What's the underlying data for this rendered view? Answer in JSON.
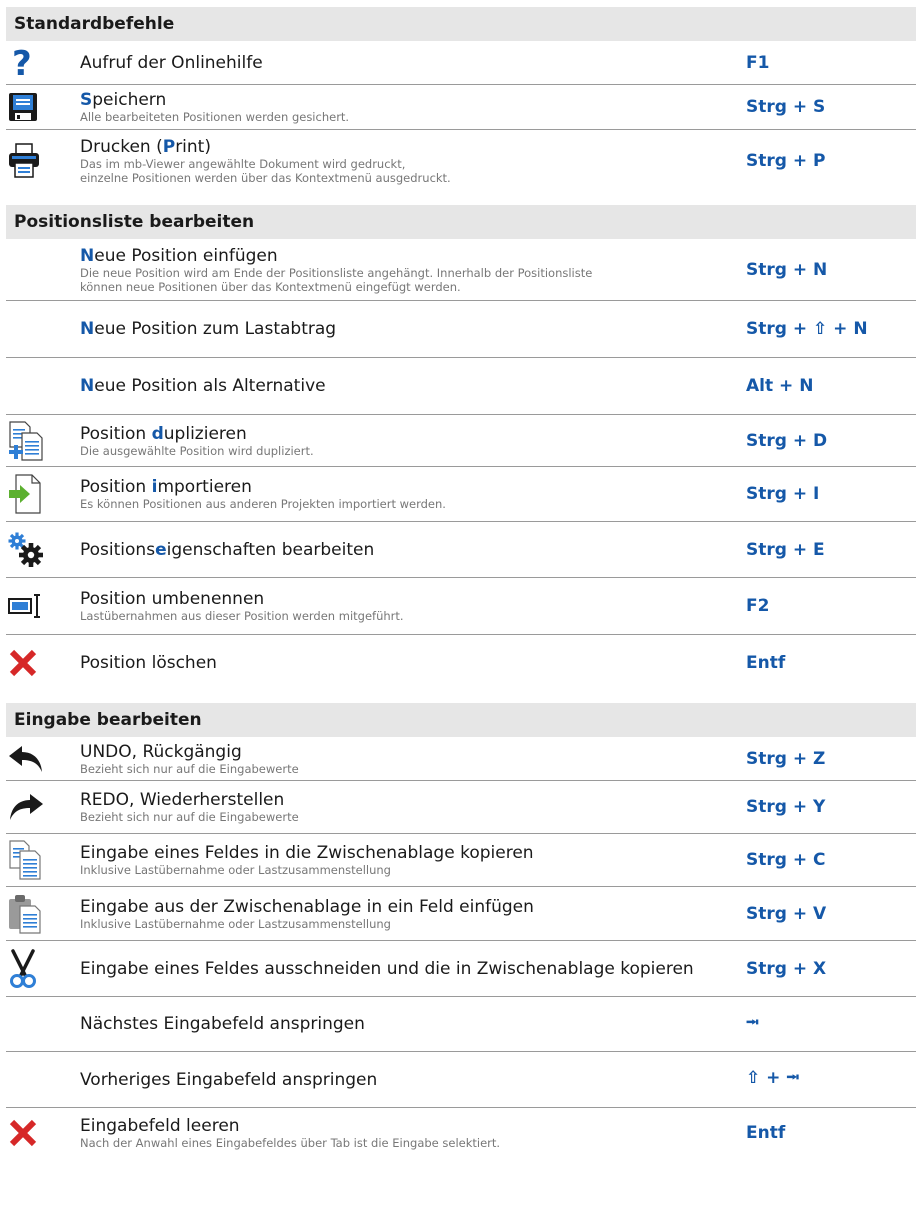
{
  "sections": {
    "standard": "Standardbefehle",
    "positions": "Positionsliste bearbeiten",
    "input": "Eingabe bearbeiten"
  },
  "rows": {
    "help": {
      "title": "Aufruf der Onlinehilfe",
      "key": "F1"
    },
    "save": {
      "hl": "S",
      "rest": "peichern",
      "sub": "Alle bearbeiteten Positionen werden gesichert.",
      "key": "Strg + S"
    },
    "print": {
      "pre": "Drucken (",
      "hl": "P",
      "post": "rint)",
      "sub1": "Das im mb-Viewer angewählte Dokument wird gedruckt,",
      "sub2": "einzelne Positionen werden über das Kontextmenü ausgedruckt.",
      "key": "Strg + P"
    },
    "newpos": {
      "hl": "N",
      "rest": "eue Position einfügen",
      "sub1": "Die neue Position wird am Ende der Positionsliste angehängt. Innerhalb der Positionsliste",
      "sub2": "können neue Positionen über das Kontextmenü eingefügt werden.",
      "key": "Strg + N"
    },
    "newload": {
      "hl": "N",
      "rest": "eue Position zum Lastabtrag",
      "key": "Strg + ⇧ + N"
    },
    "newalt": {
      "hl": "N",
      "rest": "eue Position als Alternative",
      "key": "Alt + N"
    },
    "dup": {
      "pre": "Position ",
      "hl": "d",
      "post": "uplizieren",
      "sub": "Die ausgewählte Position wird dupliziert.",
      "key": "Strg + D"
    },
    "import": {
      "pre": "Position ",
      "hl": "i",
      "post": "mportieren",
      "sub": "Es können Positionen aus anderen Projekten importiert werden.",
      "key": "Strg + I"
    },
    "props": {
      "pre": "Positions",
      "hl": "e",
      "post": "igenschaften bearbeiten",
      "key": "Strg + E"
    },
    "rename": {
      "title": "Position umbenennen",
      "sub": "Lastübernahmen aus dieser Position werden mitgeführt.",
      "key": "F2"
    },
    "delete": {
      "title": "Position löschen",
      "key": "Entf"
    },
    "undo": {
      "title": "UNDO, Rückgängig",
      "sub": "Bezieht sich nur auf die Eingabewerte",
      "key": "Strg + Z"
    },
    "redo": {
      "title": "REDO, Wiederherstellen",
      "sub": "Bezieht sich nur auf die Eingabewerte",
      "key": "Strg + Y"
    },
    "copy": {
      "title": "Eingabe eines Feldes in die Zwischenablage kopieren",
      "sub": "Inklusive Lastübernahme oder Lastzusammenstellung",
      "key": "Strg + C"
    },
    "paste": {
      "title": "Eingabe aus der Zwischenablage in ein Feld einfügen",
      "sub": "Inklusive Lastübernahme oder Lastzusammenstellung",
      "key": "Strg + V"
    },
    "cut": {
      "title": "Eingabe eines Feldes ausschneiden und die in Zwischenablage kopieren",
      "key": "Strg + X"
    },
    "next": {
      "title": "Nächstes Eingabefeld anspringen",
      "key": "⭲"
    },
    "prev": {
      "title": "Vorheriges Eingabefeld anspringen",
      "key": "⇧ + ⭲"
    },
    "clear": {
      "title": "Eingabefeld leeren",
      "sub": "Nach der Anwahl eines Eingabefeldes über Tab ist die Eingabe selektiert.",
      "key": "Entf"
    }
  },
  "icons": {
    "help": "question-icon",
    "save": "floppy-disk-icon",
    "print": "printer-icon",
    "dup": "duplicate-document-icon",
    "import": "import-document-icon",
    "props": "gears-icon",
    "rename": "rename-field-icon",
    "delete": "red-x-icon",
    "undo": "undo-arrow-icon",
    "redo": "redo-arrow-icon",
    "copy": "copy-documents-icon",
    "paste": "clipboard-icon",
    "cut": "scissors-icon",
    "clear": "red-x-icon"
  },
  "colors": {
    "accent": "#1558a8",
    "header_bg": "#e6e6e6",
    "delete_red": "#d62828",
    "import_green": "#5cb030"
  }
}
